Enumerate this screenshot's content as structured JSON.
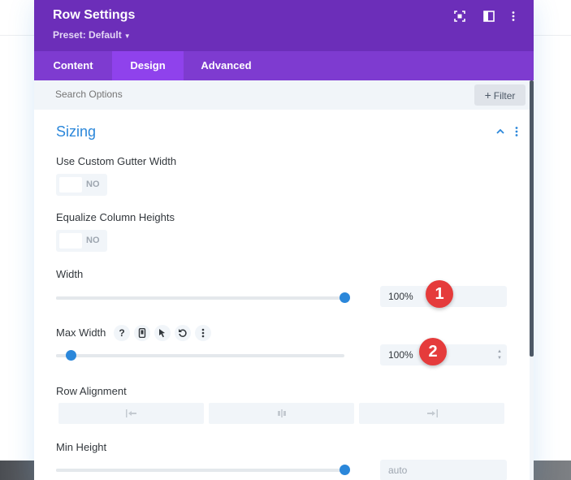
{
  "modal": {
    "title": "Row Settings",
    "preset_label": "Preset: Default",
    "header_icons": [
      "fullscreen-icon",
      "split-view-icon",
      "more-vertical-icon"
    ]
  },
  "tabs": [
    {
      "label": "Content",
      "active": false
    },
    {
      "label": "Design",
      "active": true
    },
    {
      "label": "Advanced",
      "active": false
    }
  ],
  "search": {
    "placeholder": "Search Options",
    "filter_label": "Filter"
  },
  "section": {
    "title": "Sizing",
    "expanded": true
  },
  "fields": {
    "gutter": {
      "label": "Use Custom Gutter Width",
      "toggle_text": "NO"
    },
    "equalize": {
      "label": "Equalize Column Heights",
      "toggle_text": "NO"
    },
    "width": {
      "label": "Width",
      "value": "100%",
      "slider_fraction": 1.0,
      "badge": "1"
    },
    "max_width": {
      "label": "Max Width",
      "value": "100%",
      "slider_fraction": 0.05,
      "badge": "2",
      "icons": [
        "help-icon",
        "mobile-icon",
        "cursor-icon",
        "reset-icon",
        "more-vertical-icon"
      ]
    },
    "row_alignment": {
      "label": "Row Alignment",
      "options": [
        "align-left-icon",
        "align-center-icon",
        "align-right-icon"
      ]
    },
    "min_height": {
      "label": "Min Height",
      "value": "auto",
      "slider_fraction": 1.0
    }
  },
  "colors": {
    "header_bg": "#6c2eb9",
    "tabs_bg": "#7e3bd0",
    "active_tab_bg": "#8f42ec",
    "accent_blue": "#2b87da",
    "badge_red": "#e53b3b"
  }
}
